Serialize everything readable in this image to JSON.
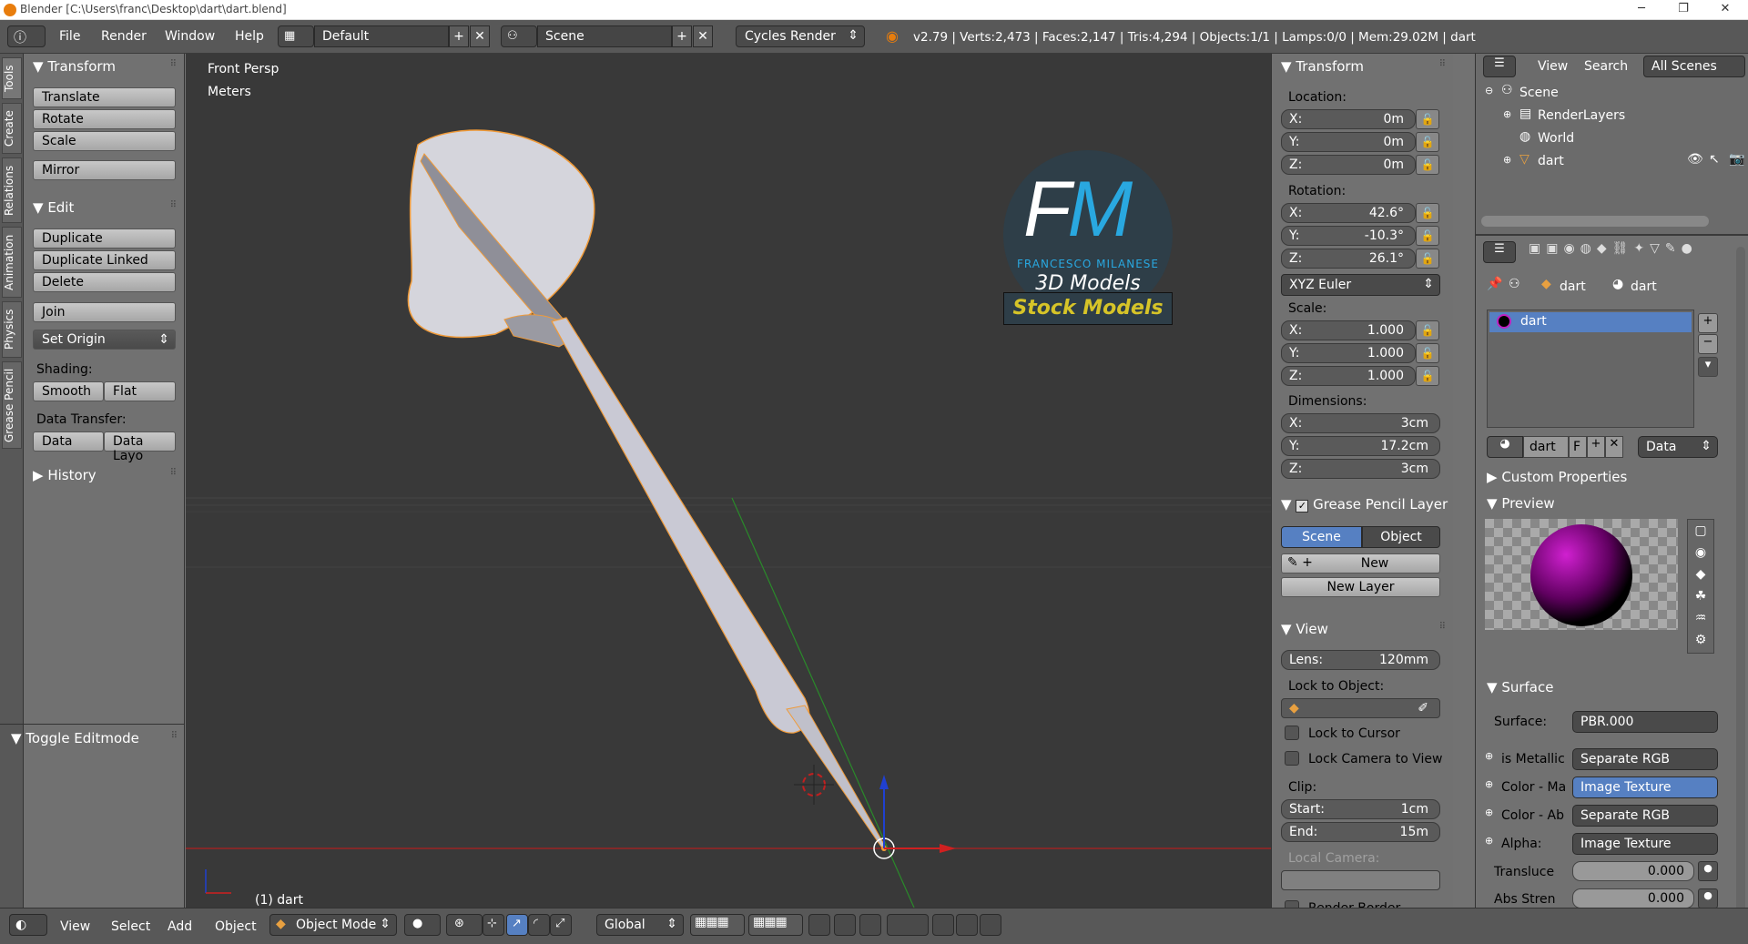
{
  "title_bar": {
    "title": "Blender [C:\\Users\\franc\\Desktop\\dart\\dart.blend]"
  },
  "top_bar": {
    "menus": [
      "File",
      "Render",
      "Window",
      "Help"
    ],
    "screen_layout": "Default",
    "scene": "Scene",
    "render_engine": "Cycles Render",
    "stats": "v2.79 | Verts:2,473 | Faces:2,147 | Tris:4,294 | Objects:1/1 | Lamps:0/0 | Mem:29.02M | dart"
  },
  "left_tabs": [
    "Tools",
    "Create",
    "Relations",
    "Animation",
    "Physics",
    "Grease Pencil"
  ],
  "tool_shelf": {
    "transform_header": "Transform",
    "translate": "Translate",
    "rotate": "Rotate",
    "scale": "Scale",
    "mirror": "Mirror",
    "edit_header": "Edit",
    "duplicate": "Duplicate",
    "duplicate_linked": "Duplicate Linked",
    "delete": "Delete",
    "join": "Join",
    "set_origin": "Set Origin",
    "shading_label": "Shading:",
    "smooth": "Smooth",
    "flat": "Flat",
    "data_transfer_label": "Data Transfer:",
    "data": "Data",
    "data_layout": "Data Layo",
    "history_header": "History",
    "toggle_editmode": "Toggle Editmode"
  },
  "viewport": {
    "view_name": "Front Persp",
    "units": "Meters",
    "object_label": "(1) dart",
    "watermark": {
      "initials": "FM",
      "name": "FRANCESCO MILANESE",
      "subtitle": "3D Models",
      "banner": "Stock Models"
    }
  },
  "viewport_header": {
    "menus": [
      "View",
      "Select",
      "Add",
      "Object"
    ],
    "mode": "Object Mode",
    "orientation": "Global"
  },
  "n_panel": {
    "transform_header": "Transform",
    "location_label": "Location:",
    "location": [
      {
        "axis": "X:",
        "value": "0m"
      },
      {
        "axis": "Y:",
        "value": "0m"
      },
      {
        "axis": "Z:",
        "value": "0m"
      }
    ],
    "rotation_label": "Rotation:",
    "rotation": [
      {
        "axis": "X:",
        "value": "42.6°"
      },
      {
        "axis": "Y:",
        "value": "-10.3°"
      },
      {
        "axis": "Z:",
        "value": "26.1°"
      }
    ],
    "rotation_mode": "XYZ Euler",
    "scale_label": "Scale:",
    "scale": [
      {
        "axis": "X:",
        "value": "1.000"
      },
      {
        "axis": "Y:",
        "value": "1.000"
      },
      {
        "axis": "Z:",
        "value": "1.000"
      }
    ],
    "dimensions_label": "Dimensions:",
    "dimensions": [
      {
        "axis": "X:",
        "value": "3cm"
      },
      {
        "axis": "Y:",
        "value": "17.2cm"
      },
      {
        "axis": "Z:",
        "value": "3cm"
      }
    ],
    "grease_pencil_header": "Grease Pencil Layer",
    "gp_scene": "Scene",
    "gp_object": "Object",
    "gp_new": "New",
    "gp_new_layer": "New Layer",
    "view_header": "View",
    "lens_label": "Lens:",
    "lens_value": "120mm",
    "lock_to_object": "Lock to Object:",
    "lock_to_cursor": "Lock to Cursor",
    "lock_camera": "Lock Camera to View",
    "clip_label": "Clip:",
    "clip_start_label": "Start:",
    "clip_start": "1cm",
    "clip_end_label": "End:",
    "clip_end": "15m",
    "local_camera": "Local Camera:",
    "render_border": "Render Border"
  },
  "outliner": {
    "menus": [
      "View",
      "Search"
    ],
    "filter": "All Scenes",
    "items": [
      "Scene",
      "RenderLayers",
      "World",
      "dart"
    ]
  },
  "properties": {
    "breadcrumb_object": "dart",
    "breadcrumb_material": "dart",
    "material_slot": "dart",
    "material_name": "dart",
    "material_f": "F",
    "link_to": "Data",
    "custom_properties": "Custom Properties",
    "preview_header": "Preview",
    "surface_header": "Surface",
    "surface_label": "Surface:",
    "surface_value": "PBR.000",
    "inputs": [
      {
        "label": "is Metallic",
        "value": "Separate RGB"
      },
      {
        "label": "Color - Ma",
        "value": "Image Texture"
      },
      {
        "label": "Color - Ab",
        "value": "Separate RGB"
      },
      {
        "label": "Alpha:",
        "value": "Image Texture"
      }
    ],
    "translucency_label": "Transluce",
    "translucency": "0.000",
    "abs_strength_label": "Abs Stren",
    "abs_strength": "0.000"
  },
  "colors": {
    "accent": "#5680c2",
    "object_outline": "#f09a38",
    "x_axis": "#d02020",
    "y_axis": "#2a8a2a",
    "z_axis": "#2040d0"
  }
}
